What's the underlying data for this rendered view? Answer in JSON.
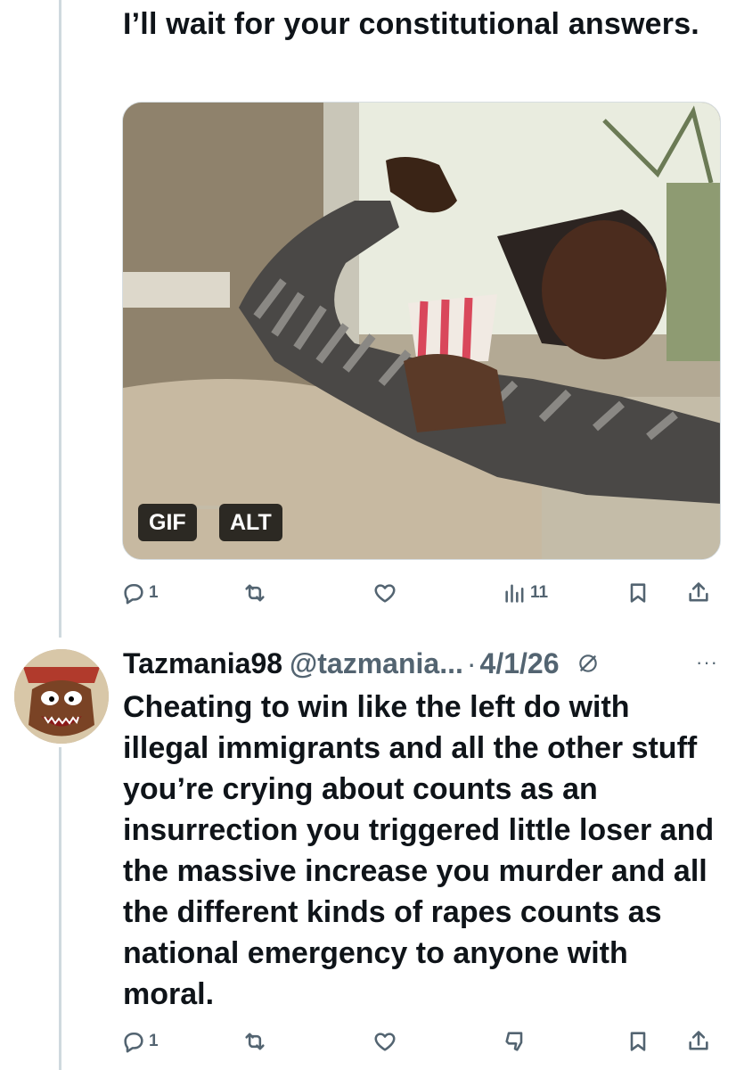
{
  "post1": {
    "text": "I’ll wait for your constitutional answers.",
    "media": {
      "badge_gif": "GIF",
      "badge_alt": "ALT",
      "description_icon": "popcorn-gif"
    },
    "actions": {
      "replies": "1",
      "reposts": "",
      "likes": "",
      "views": "11"
    }
  },
  "post2": {
    "display_name": "Tazmania98",
    "handle": "@tazmania...",
    "separator": "·",
    "date": "4/1/26",
    "text": "Cheating to win like the left do with illegal immigrants and all the other stuff you’re crying about counts as an insurrection you triggered little loser and the massive increase you murder and all the different kinds of rapes counts as national emergency to anyone with moral.",
    "more": "···",
    "actions": {
      "replies": "1",
      "reposts": "",
      "likes": ""
    }
  },
  "colors": {
    "text": "#0f1419",
    "muted": "#536471",
    "thread_line": "#cfd9de"
  },
  "icons": [
    "reply-icon",
    "repost-icon",
    "like-icon",
    "views-icon",
    "bookmark-icon",
    "share-icon",
    "grok-icon",
    "more-icon",
    "downvote-icon"
  ]
}
